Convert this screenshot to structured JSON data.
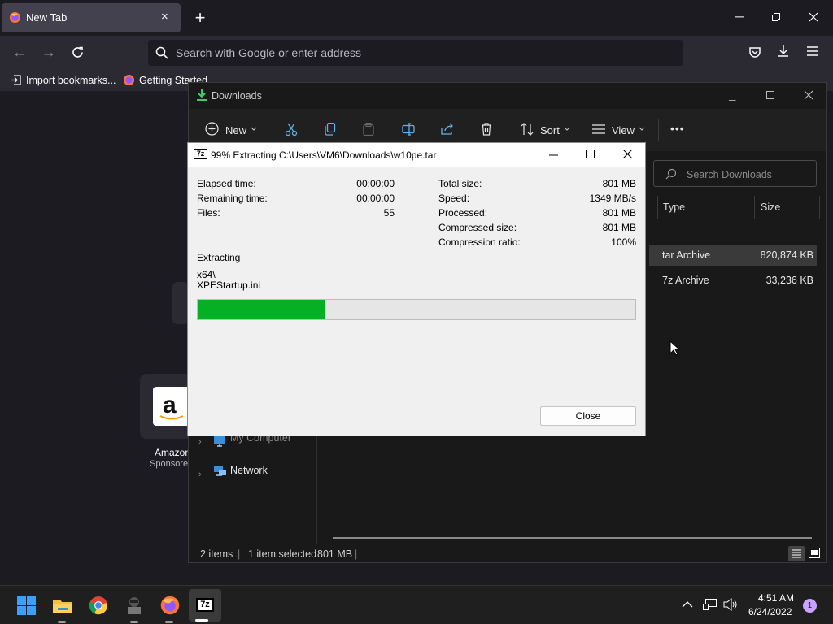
{
  "browser": {
    "tab_title": "New Tab",
    "tab_close": "×",
    "new_tab": "+",
    "url_placeholder": "Search with Google or enter address",
    "bookmarks": [
      "Import bookmarks...",
      "Getting Started"
    ],
    "shortcuts": [
      {
        "label": "Amazon",
        "sublabel": "Sponsored"
      }
    ]
  },
  "explorer": {
    "title": "Downloads",
    "toolbar": {
      "new": "New",
      "sort": "Sort",
      "view": "View",
      "more": "•••"
    },
    "search_placeholder": "Search Downloads",
    "columns": [
      "Type",
      "Size"
    ],
    "rows": [
      {
        "type": "tar Archive",
        "size": "820,874 KB",
        "selected": true
      },
      {
        "type": "7z Archive",
        "size": "33,236 KB",
        "selected": false
      }
    ],
    "nav": [
      "My Computer",
      "Network"
    ],
    "status": {
      "items": "2 items",
      "selected": "1 item selected",
      "size": "801 MB"
    }
  },
  "dialog": {
    "icon_text": "7z",
    "title": "99% Extracting C:\\Users\\VM6\\Downloads\\w10pe.tar",
    "left_stats": [
      {
        "label": "Elapsed time:",
        "value": "00:00:00"
      },
      {
        "label": "Remaining time:",
        "value": "00:00:00"
      },
      {
        "label": "Files:",
        "value": "55"
      }
    ],
    "right_stats": [
      {
        "label": "Total size:",
        "value": "801 MB"
      },
      {
        "label": "Speed:",
        "value": "1349 MB/s"
      },
      {
        "label": "Processed:",
        "value": "801 MB"
      },
      {
        "label": "Compressed size:",
        "value": "801 MB"
      },
      {
        "label": "Compression ratio:",
        "value": "100%"
      }
    ],
    "status_label": "Extracting",
    "current_dir": "x64\\",
    "current_file": "XPEStartup.ini",
    "progress_fraction": 0.29,
    "close_label": "Close",
    "progress_color": "#06b025"
  },
  "taskbar": {
    "time": "4:51 AM",
    "date": "6/24/2022",
    "notification_count": "1",
    "apps": [
      "windows-start",
      "file-explorer",
      "chrome",
      "app-icon",
      "firefox",
      "7zip"
    ],
    "active_app_text": "7z"
  },
  "colors": {
    "accent_blue": "#5fb2f0",
    "firefox_orange": "#ff7139",
    "progress_green": "#06b025"
  }
}
